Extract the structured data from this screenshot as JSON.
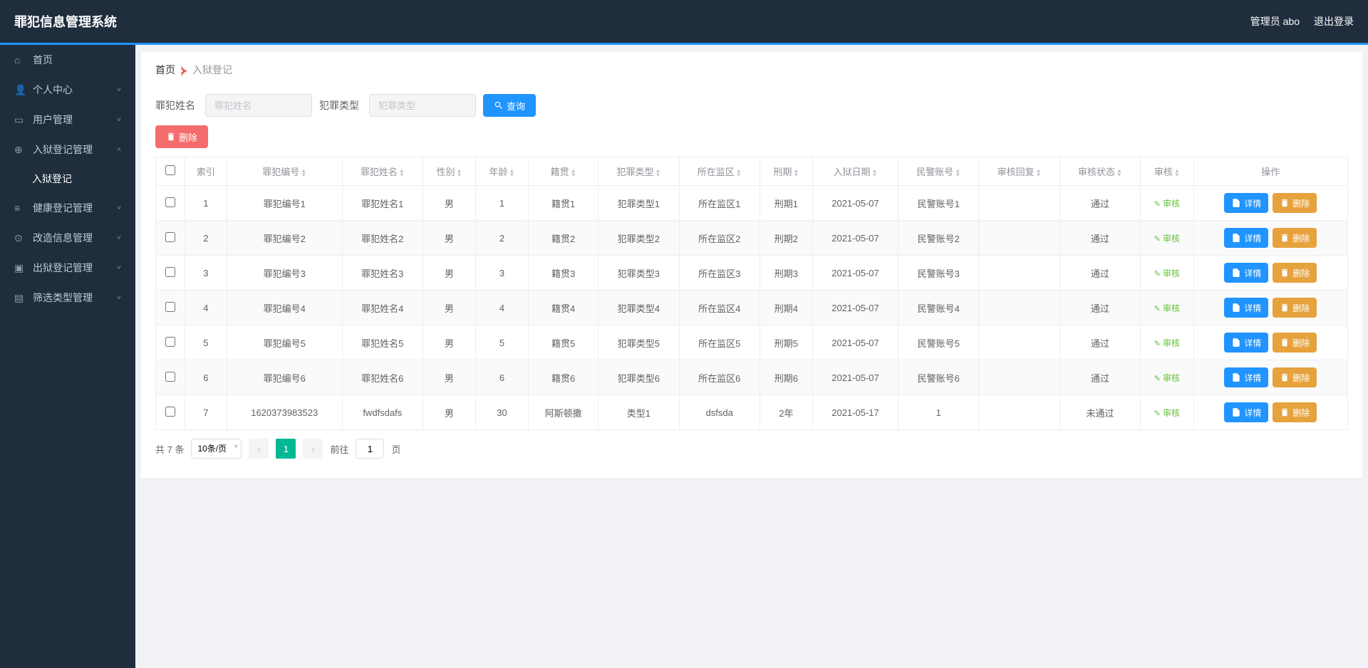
{
  "header": {
    "title": "罪犯信息管理系统",
    "admin_label": "管理员 abo",
    "logout_label": "退出登录"
  },
  "sidebar": {
    "items": [
      {
        "icon": "home",
        "label": "首页",
        "expandable": false
      },
      {
        "icon": "user",
        "label": "个人中心",
        "expandable": true
      },
      {
        "icon": "users",
        "label": "用户管理",
        "expandable": true
      },
      {
        "icon": "register",
        "label": "入狱登记管理",
        "expandable": true,
        "open": true,
        "children": [
          {
            "label": "入狱登记"
          }
        ]
      },
      {
        "icon": "health",
        "label": "健康登记管理",
        "expandable": true
      },
      {
        "icon": "reform",
        "label": "改造信息管理",
        "expandable": true
      },
      {
        "icon": "exit",
        "label": "出狱登记管理",
        "expandable": true
      },
      {
        "icon": "filter",
        "label": "筛选类型管理",
        "expandable": true
      }
    ]
  },
  "breadcrumb": {
    "home": "首页",
    "current": "入狱登记"
  },
  "search": {
    "name_label": "罪犯姓名",
    "name_placeholder": "罪犯姓名",
    "type_label": "犯罪类型",
    "type_placeholder": "犯罪类型",
    "query_btn": "查询"
  },
  "toolbar": {
    "delete_btn": "删除"
  },
  "table": {
    "columns": [
      "索引",
      "罪犯编号",
      "罪犯姓名",
      "性别",
      "年龄",
      "籍贯",
      "犯罪类型",
      "所在监区",
      "刑期",
      "入狱日期",
      "民警账号",
      "审核回复",
      "审核状态",
      "审核",
      "操作"
    ],
    "audit_link": "审核",
    "detail_btn": "详情",
    "delete_btn": "删除",
    "rows": [
      {
        "idx": "1",
        "no": "罪犯编号1",
        "name": "罪犯姓名1",
        "gender": "男",
        "age": "1",
        "origin": "籍贯1",
        "crime": "犯罪类型1",
        "area": "所在监区1",
        "term": "刑期1",
        "date": "2021-05-07",
        "police": "民警账号1",
        "reply": "",
        "status": "通过"
      },
      {
        "idx": "2",
        "no": "罪犯编号2",
        "name": "罪犯姓名2",
        "gender": "男",
        "age": "2",
        "origin": "籍贯2",
        "crime": "犯罪类型2",
        "area": "所在监区2",
        "term": "刑期2",
        "date": "2021-05-07",
        "police": "民警账号2",
        "reply": "",
        "status": "通过"
      },
      {
        "idx": "3",
        "no": "罪犯编号3",
        "name": "罪犯姓名3",
        "gender": "男",
        "age": "3",
        "origin": "籍贯3",
        "crime": "犯罪类型3",
        "area": "所在监区3",
        "term": "刑期3",
        "date": "2021-05-07",
        "police": "民警账号3",
        "reply": "",
        "status": "通过"
      },
      {
        "idx": "4",
        "no": "罪犯编号4",
        "name": "罪犯姓名4",
        "gender": "男",
        "age": "4",
        "origin": "籍贯4",
        "crime": "犯罪类型4",
        "area": "所在监区4",
        "term": "刑期4",
        "date": "2021-05-07",
        "police": "民警账号4",
        "reply": "",
        "status": "通过"
      },
      {
        "idx": "5",
        "no": "罪犯编号5",
        "name": "罪犯姓名5",
        "gender": "男",
        "age": "5",
        "origin": "籍贯5",
        "crime": "犯罪类型5",
        "area": "所在监区5",
        "term": "刑期5",
        "date": "2021-05-07",
        "police": "民警账号5",
        "reply": "",
        "status": "通过"
      },
      {
        "idx": "6",
        "no": "罪犯编号6",
        "name": "罪犯姓名6",
        "gender": "男",
        "age": "6",
        "origin": "籍贯6",
        "crime": "犯罪类型6",
        "area": "所在监区6",
        "term": "刑期6",
        "date": "2021-05-07",
        "police": "民警账号6",
        "reply": "",
        "status": "通过"
      },
      {
        "idx": "7",
        "no": "1620373983523",
        "name": "fwdfsdafs",
        "gender": "男",
        "age": "30",
        "origin": "阿斯顿撒",
        "crime": "类型1",
        "area": "dsfsda",
        "term": "2年",
        "date": "2021-05-17",
        "police": "1",
        "reply": "",
        "status": "未通过"
      }
    ]
  },
  "pagination": {
    "total_text": "共 7 条",
    "page_size": "10条/页",
    "current_page": "1",
    "goto_prefix": "前往",
    "goto_value": "1",
    "goto_suffix": "页"
  }
}
